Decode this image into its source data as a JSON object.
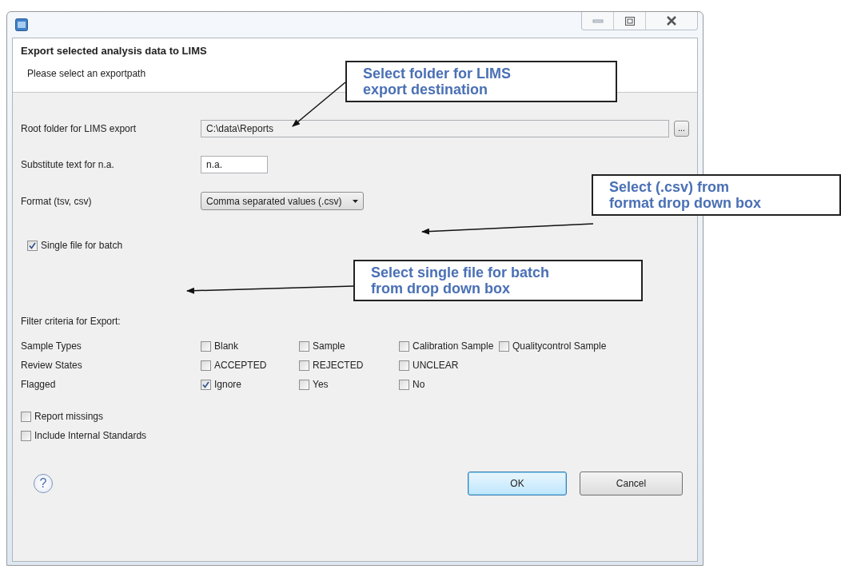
{
  "header": {
    "title": "Export selected analysis data to LIMS",
    "subtitle": "Please select an exportpath"
  },
  "fields": [
    {
      "kind": "path",
      "label": "Root folder for LIMS export",
      "value": "C:\\data\\Reports",
      "button": "..."
    },
    {
      "kind": "text",
      "label": "Substitute text for n.a.",
      "value": "n.a."
    },
    {
      "kind": "select",
      "label": "Format (tsv, csv)",
      "value": "Comma separated values (.csv)"
    }
  ],
  "single_file": {
    "label": "Single file for batch",
    "checked": true
  },
  "filter": {
    "title": "Filter criteria for Export:",
    "rows": [
      {
        "label": "Sample Types",
        "options": [
          {
            "label": "Blank",
            "checked": false
          },
          {
            "label": "Sample",
            "checked": false
          },
          {
            "label": "Calibration Sample",
            "checked": false
          },
          {
            "label": "Qualitycontrol Sample",
            "checked": false
          }
        ]
      },
      {
        "label": "Review States",
        "options": [
          {
            "label": "ACCEPTED",
            "checked": false
          },
          {
            "label": "REJECTED",
            "checked": false
          },
          {
            "label": "UNCLEAR",
            "checked": false
          }
        ]
      },
      {
        "label": "Flagged",
        "options": [
          {
            "label": "Ignore",
            "checked": true
          },
          {
            "label": "Yes",
            "checked": false
          },
          {
            "label": "No",
            "checked": false
          }
        ]
      }
    ]
  },
  "options": [
    {
      "label": "Report missings",
      "checked": false
    },
    {
      "label": "Include Internal Standards",
      "checked": false
    }
  ],
  "help": "?",
  "buttons": [
    {
      "label": "OK",
      "default": true
    },
    {
      "label": "Cancel",
      "default": false
    }
  ],
  "callouts": [
    {
      "text": "Select folder for LIMS\nexport destination"
    },
    {
      "text": "Select (.csv) from\nformat drop down box"
    },
    {
      "text": "Select single file for batch\nfrom drop down box"
    }
  ]
}
